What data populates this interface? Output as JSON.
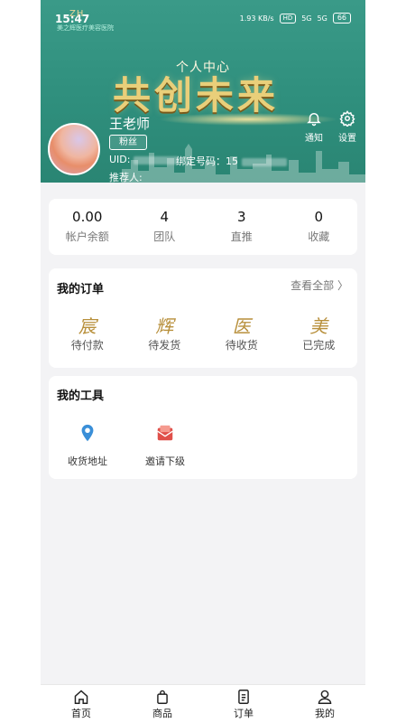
{
  "status_bar": {
    "time": "15:47",
    "logo": "ZH",
    "logo_sub": "美之辉医疗美容医院",
    "net_speed": "1.93 KB/s",
    "hd": "HD",
    "sig1": "5G",
    "sig2": "5G",
    "battery": "66"
  },
  "banner": {
    "subtitle": "个人中心",
    "title": "共创未来"
  },
  "profile": {
    "name": "王老师",
    "badge": "粉丝",
    "uid_label": "UID:",
    "bind_label": "绑定号码：15",
    "referrer_label": "推荐人:"
  },
  "header_actions": [
    {
      "label": "通知",
      "icon": "bell-icon"
    },
    {
      "label": "设置",
      "icon": "gear-icon"
    }
  ],
  "stats": [
    {
      "value": "0.00",
      "label": "帐户余额"
    },
    {
      "value": "4",
      "label": "团队"
    },
    {
      "value": "3",
      "label": "直推"
    },
    {
      "value": "0",
      "label": "收藏"
    }
  ],
  "orders": {
    "title": "我的订单",
    "view_all": "查看全部 〉",
    "items": [
      {
        "glyph": "宸",
        "label": "待付款"
      },
      {
        "glyph": "辉",
        "label": "待发货"
      },
      {
        "glyph": "医",
        "label": "待收货"
      },
      {
        "glyph": "美",
        "label": "已完成"
      }
    ]
  },
  "tools": {
    "title": "我的工具",
    "items": [
      {
        "label": "收货地址",
        "icon": "location-pin-icon",
        "color": "#3a8fd8"
      },
      {
        "label": "邀请下级",
        "icon": "invite-envelope-icon",
        "color": "#e0504a"
      }
    ]
  },
  "tabbar": [
    {
      "label": "首页",
      "icon": "home-icon"
    },
    {
      "label": "商品",
      "icon": "shopping-bag-icon"
    },
    {
      "label": "订单",
      "icon": "order-list-icon"
    },
    {
      "label": "我的",
      "icon": "profile-icon"
    }
  ]
}
